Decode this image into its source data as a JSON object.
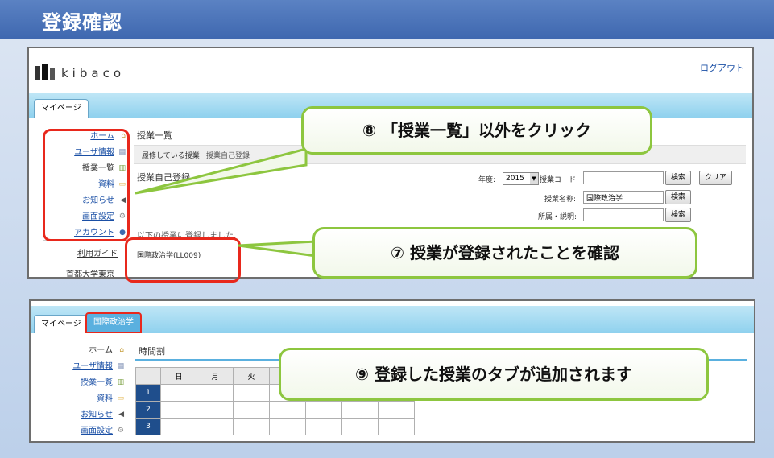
{
  "banner": {
    "title": "登録確認"
  },
  "top_screen": {
    "logo_text": "kibaco",
    "logout": "ログアウト",
    "tab_mypage": "マイページ",
    "nav": [
      {
        "label": "ホーム",
        "link": true,
        "icon": "home-icon"
      },
      {
        "label": "ユーザ情報",
        "link": true,
        "icon": "id-card-icon"
      },
      {
        "label": "授業一覧",
        "link": false,
        "icon": "books-icon"
      },
      {
        "label": "資料",
        "link": true,
        "icon": "folder-icon"
      },
      {
        "label": "お知らせ",
        "link": true,
        "icon": "megaphone-icon"
      },
      {
        "label": "画面設定",
        "link": true,
        "icon": "gear-icon"
      },
      {
        "label": "アカウント",
        "link": true,
        "icon": "user-icon"
      }
    ],
    "guide": "利用ガイド",
    "office": "首都大学東京",
    "section_title": "授業一覧",
    "subtab_active": "履修している授業",
    "subtab_other": "授業自己登録",
    "form_title": "授業自己登録",
    "year_label": "年度:",
    "year_value": "2015",
    "code_label": "授業コード:",
    "name_label": "授業名称:",
    "name_value": "国際政治学",
    "dept_label": "所属・説明:",
    "search": "検索",
    "clear": "クリア",
    "registered_msg": "以下の授業に登録しました.",
    "registered_course": "国際政治学(LL009)"
  },
  "bottom_screen": {
    "tab_mypage": "マイページ",
    "tab_course": "国際政治学",
    "nav": [
      {
        "label": "ホーム",
        "link": false,
        "icon": "home-icon"
      },
      {
        "label": "ユーザ情報",
        "link": true,
        "icon": "id-card-icon"
      },
      {
        "label": "授業一覧",
        "link": true,
        "icon": "books-icon"
      },
      {
        "label": "資料",
        "link": true,
        "icon": "folder-icon"
      },
      {
        "label": "お知らせ",
        "link": true,
        "icon": "megaphone-icon"
      },
      {
        "label": "画面設定",
        "link": true,
        "icon": "gear-icon"
      }
    ],
    "timetable_title": "時間割",
    "days": [
      "日",
      "月",
      "火"
    ],
    "periods": [
      "1",
      "2",
      "3"
    ]
  },
  "callouts": {
    "c8": "⑧ 「授業一覧」以外をクリック",
    "c7": "⑦ 授業が登録されたことを確認",
    "c9": "⑨ 登録した授業のタブが追加されます"
  },
  "colors": {
    "callout_border": "#8dc63f",
    "highlight": "#e8281c",
    "banner": "#4a72b8"
  }
}
